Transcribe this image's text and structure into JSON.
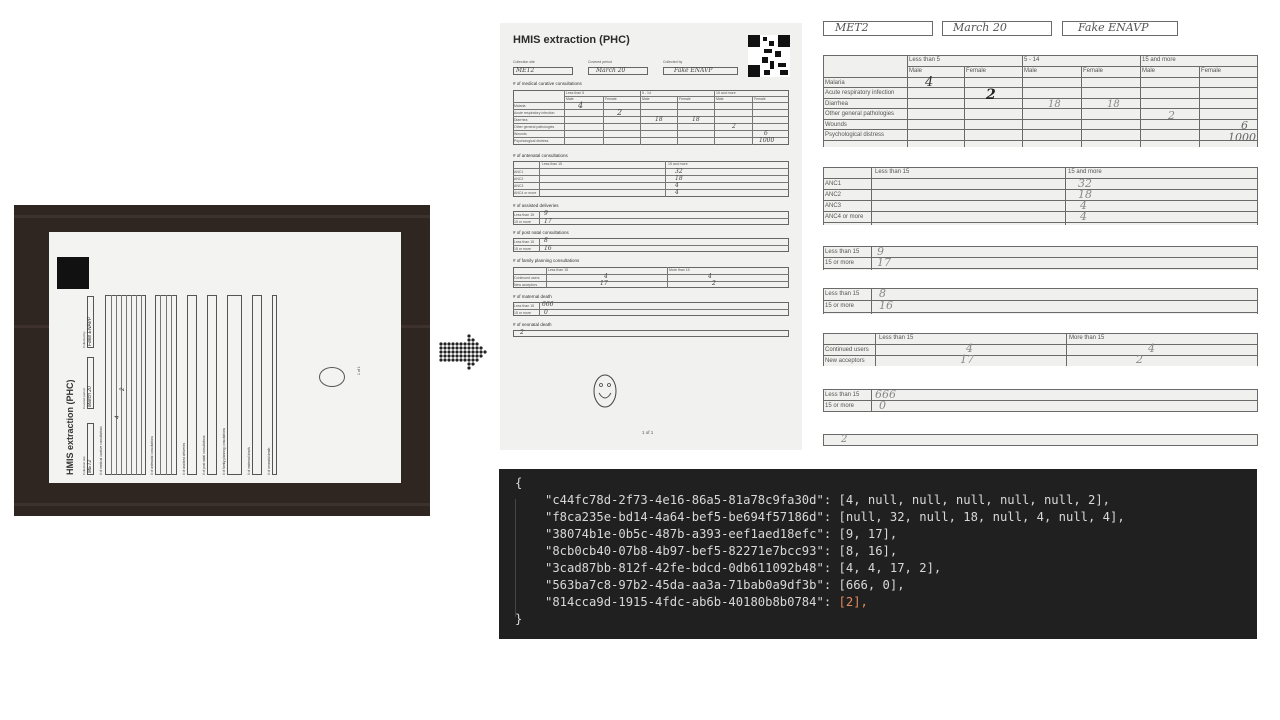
{
  "photo": {
    "title": "HMIS extraction (PHC)",
    "collection_site_label": "Collection site",
    "covered_period_label": "Covered period",
    "collected_by_label": "Collected by",
    "collection_site_value": "MET2",
    "covered_period_value": "March 20",
    "collected_by_value": "Fake ENAVP",
    "page_number": "1 of 1",
    "sections": [
      "# of medical curative consultations",
      "# of antenatal consultations",
      "# of assisted deliveries",
      "# of post natal consultations",
      "# of family planning consultations",
      "# of maternal death",
      "# of neonatal death"
    ]
  },
  "document": {
    "title": "HMIS extraction (PHC)",
    "collection_site_label": "Collection site",
    "covered_period_label": "Covered period",
    "collected_by_label": "Collected by",
    "collection_site_value": "MET2",
    "covered_period_value": "March 20",
    "collected_by_value": "Fake ENAVP",
    "sec_curative": "# of medical curative consultations",
    "sec_antenatal": "# of antenatal consultations",
    "sec_assisted": "# of assisted deliveries",
    "sec_postnatal": "# of post natal consultations",
    "sec_family": "# of family planning consultations",
    "sec_maternal": "# of maternal death",
    "sec_neonatal": "# of neonatal death",
    "page_number": "1 of 1"
  },
  "curative": {
    "age_groups": [
      "Less than 5",
      "5 - 14",
      "15 and more"
    ],
    "sex_headers": [
      "Male",
      "Female",
      "Male",
      "Female",
      "Male",
      "Female"
    ],
    "rows": [
      {
        "label": "Malaria",
        "values": [
          "4",
          "",
          "",
          "",
          "",
          ""
        ]
      },
      {
        "label": "Acute respiratory infection",
        "values": [
          "",
          "2",
          "",
          "",
          "",
          ""
        ]
      },
      {
        "label": "Diarrhea",
        "values": [
          "",
          "",
          "18",
          "18",
          "",
          ""
        ]
      },
      {
        "label": "Other general pathologies",
        "values": [
          "",
          "",
          "",
          "",
          "2",
          ""
        ]
      },
      {
        "label": "Wounds",
        "values": [
          "",
          "",
          "",
          "",
          "",
          "6"
        ]
      },
      {
        "label": "Psychological distress",
        "values": [
          "",
          "",
          "",
          "",
          "",
          "1000"
        ]
      }
    ]
  },
  "antenatal": {
    "headers": [
      "Less than 15",
      "15 and more"
    ],
    "rows": [
      {
        "label": "ANC1",
        "values": [
          "",
          "32"
        ]
      },
      {
        "label": "ANC2",
        "values": [
          "",
          "18"
        ]
      },
      {
        "label": "ANC3",
        "values": [
          "",
          "4"
        ]
      },
      {
        "label": "ANC4 or more",
        "values": [
          "",
          "4"
        ]
      }
    ]
  },
  "assisted": {
    "rows": [
      {
        "label": "Less than 15",
        "value": "9"
      },
      {
        "label": "15 or more",
        "value": "17"
      }
    ]
  },
  "postnatal": {
    "rows": [
      {
        "label": "Less than 15",
        "value": "8"
      },
      {
        "label": "15 or more",
        "value": "16"
      }
    ]
  },
  "family": {
    "headers": [
      "Less than 15",
      "More than 15"
    ],
    "rows": [
      {
        "label": "Continued users",
        "values": [
          "4",
          "4"
        ]
      },
      {
        "label": "New acceptors",
        "values": [
          "17",
          "2"
        ]
      }
    ]
  },
  "maternal": {
    "rows": [
      {
        "label": "Less than 15",
        "value": "666"
      },
      {
        "label": "15 or more",
        "value": "0"
      }
    ]
  },
  "neonatal": {
    "value": "2"
  },
  "json_output": {
    "open": "{",
    "close": "}",
    "entries": [
      {
        "key": "\"c44fc78d-2f73-4e16-86a5-81a78c9fa30d\"",
        "value": "[4, null, null, null, null, null, 2],"
      },
      {
        "key": "\"f8ca235e-bd14-4a64-bef5-be694f57186d\"",
        "value": "[null, 32, null, 18, null, 4, null, 4],"
      },
      {
        "key": "\"38074b1e-0b5c-487b-a393-eef1aed18efc\"",
        "value": "[9, 17],"
      },
      {
        "key": "\"8cb0cb40-07b8-4b97-bef5-82271e7bcc93\"",
        "value": "[8, 16],"
      },
      {
        "key": "\"3cad87bb-812f-42fe-bdcd-0db611092b48\"",
        "value": "[4, 4, 17, 2],"
      },
      {
        "key": "\"563ba7c8-97b2-45da-aa3a-71bab0a9df3b\"",
        "value": "[666, 0],"
      },
      {
        "key": "\"814cca9d-1915-4fdc-ab6b-40180b8b0784\"",
        "value": "[2],"
      }
    ]
  },
  "colors": {
    "code_bg": "#202020",
    "code_text": "#d8d8d8",
    "code_highlight": "#e28a5b",
    "photo_bg": "#2f2622"
  }
}
